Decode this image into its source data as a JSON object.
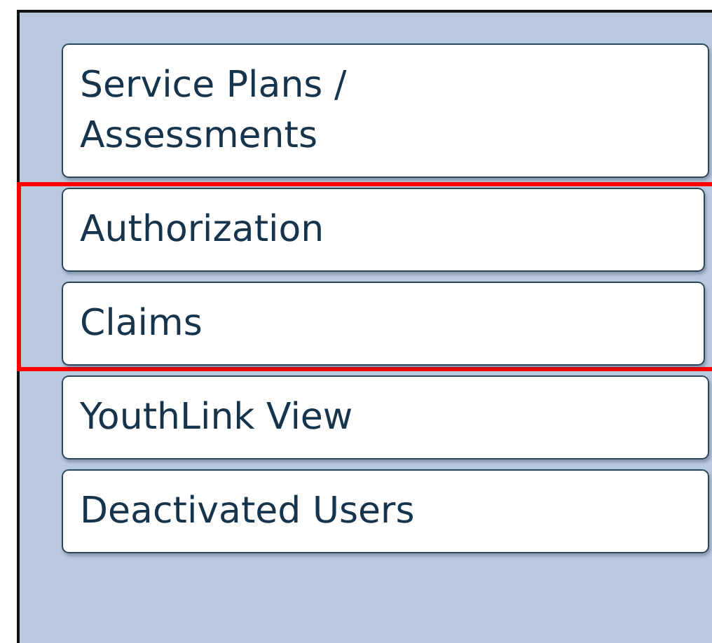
{
  "menu_items": [
    {
      "label": "Service Plans /\nAssessments",
      "highlighted": false
    },
    {
      "label": "Authorization",
      "highlighted": true
    },
    {
      "label": "Claims",
      "highlighted": true
    },
    {
      "label": "YouthLink View",
      "highlighted": false
    },
    {
      "label": "Deactivated Users",
      "highlighted": false
    }
  ]
}
